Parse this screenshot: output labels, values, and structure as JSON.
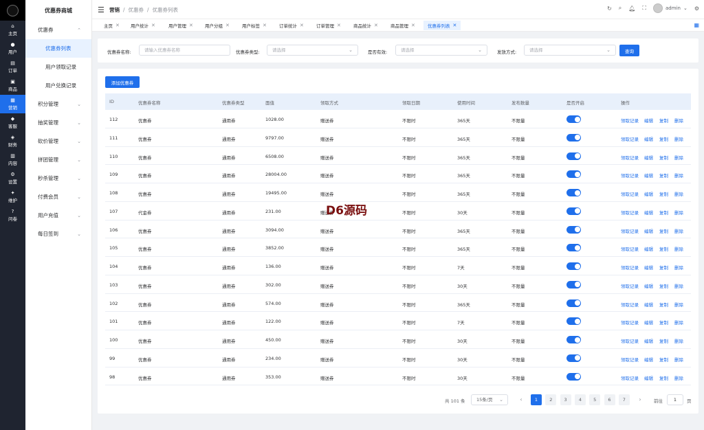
{
  "rail": {
    "items": [
      {
        "label": "主页",
        "icon": "home-icon"
      },
      {
        "label": "用户",
        "icon": "user-icon"
      },
      {
        "label": "订单",
        "icon": "order-icon"
      },
      {
        "label": "商品",
        "icon": "product-icon"
      },
      {
        "label": "营销",
        "icon": "marketing-icon",
        "active": true
      },
      {
        "label": "客服",
        "icon": "service-icon"
      },
      {
        "label": "财务",
        "icon": "finance-icon"
      },
      {
        "label": "内容",
        "icon": "content-icon"
      },
      {
        "label": "设置",
        "icon": "settings-icon"
      },
      {
        "label": "维护",
        "icon": "maintain-icon"
      },
      {
        "label": "问卷",
        "icon": "survey-icon"
      }
    ]
  },
  "sidebar": {
    "title": "优惠券商城",
    "groups": [
      {
        "label": "优惠券",
        "expanded": true,
        "children": [
          "优惠券列表",
          "用户领取记录",
          "用户兑换记录"
        ]
      },
      {
        "label": "积分管理"
      },
      {
        "label": "抽奖管理"
      },
      {
        "label": "砍价管理"
      },
      {
        "label": "拼团管理"
      },
      {
        "label": "秒杀管理"
      },
      {
        "label": "付费会员"
      },
      {
        "label": "用户充值"
      },
      {
        "label": "每日签到"
      }
    ]
  },
  "header": {
    "breadcrumb": [
      "营销",
      "优惠券",
      "优惠券列表"
    ],
    "username": "admin"
  },
  "tabs": [
    "主页",
    "用户统计",
    "用户管理",
    "用户分组",
    "用户标签",
    "订单统计",
    "订单管理",
    "商品统计",
    "商品管理",
    "优惠券列表"
  ],
  "filters": {
    "name_label": "优惠券名称:",
    "name_placeholder": "请输入优惠券名称",
    "type_label": "优惠券类型:",
    "type_placeholder": "请选择",
    "valid_label": "是否有效:",
    "valid_placeholder": "请选择",
    "issue_label": "发放方式:",
    "issue_placeholder": "请选择",
    "query_label": "查询"
  },
  "add_button": "添加优惠券",
  "table": {
    "headers": [
      "ID",
      "优惠券名称",
      "优惠券类型",
      "面值",
      "领取方式",
      "领取日期",
      "使用时间",
      "发布数量",
      "是否开启",
      "操作"
    ],
    "rows": [
      [
        "112",
        "优惠券",
        "通用券",
        "1028.00",
        "赠送券",
        "不限时",
        "365天",
        "不限量"
      ],
      [
        "111",
        "优惠券",
        "通用券",
        "9797.00",
        "赠送券",
        "不限时",
        "365天",
        "不限量"
      ],
      [
        "110",
        "优惠券",
        "通用券",
        "6508.00",
        "赠送券",
        "不限时",
        "365天",
        "不限量"
      ],
      [
        "109",
        "优惠券",
        "通用券",
        "28004.00",
        "赠送券",
        "不限时",
        "365天",
        "不限量"
      ],
      [
        "108",
        "优惠券",
        "通用券",
        "19495.00",
        "赠送券",
        "不限时",
        "365天",
        "不限量"
      ],
      [
        "107",
        "代金券",
        "通用券",
        "231.00",
        "赠送券",
        "不限时",
        "30天",
        "不限量"
      ],
      [
        "106",
        "优惠券",
        "通用券",
        "3094.00",
        "赠送券",
        "不限时",
        "365天",
        "不限量"
      ],
      [
        "105",
        "优惠券",
        "通用券",
        "3852.00",
        "赠送券",
        "不限时",
        "365天",
        "不限量"
      ],
      [
        "104",
        "优惠券",
        "通用券",
        "136.00",
        "赠送券",
        "不限时",
        "7天",
        "不限量"
      ],
      [
        "103",
        "优惠券",
        "通用券",
        "302.00",
        "赠送券",
        "不限时",
        "30天",
        "不限量"
      ],
      [
        "102",
        "优惠券",
        "通用券",
        "574.00",
        "赠送券",
        "不限时",
        "365天",
        "不限量"
      ],
      [
        "101",
        "优惠券",
        "通用券",
        "122.00",
        "赠送券",
        "不限时",
        "7天",
        "不限量"
      ],
      [
        "100",
        "优惠券",
        "通用券",
        "450.00",
        "赠送券",
        "不限时",
        "30天",
        "不限量"
      ],
      [
        "99",
        "优惠券",
        "通用券",
        "234.00",
        "赠送券",
        "不限时",
        "30天",
        "不限量"
      ],
      [
        "98",
        "优惠券",
        "通用券",
        "353.00",
        "赠送券",
        "不限时",
        "30天",
        "不限量"
      ]
    ],
    "actions": [
      "领取记录",
      "编辑",
      "复制",
      "删除"
    ]
  },
  "pagination": {
    "total": "共 101 条",
    "page_size": "15条/页",
    "pages": [
      "1",
      "2",
      "3",
      "4",
      "5",
      "6",
      "7"
    ],
    "current": "1",
    "goto_label": "前往",
    "goto_value": "1",
    "page_unit": "页"
  },
  "watermark": "D6源码",
  "colors": {
    "primary": "#1f6feb",
    "rail_bg": "#1f2430"
  }
}
